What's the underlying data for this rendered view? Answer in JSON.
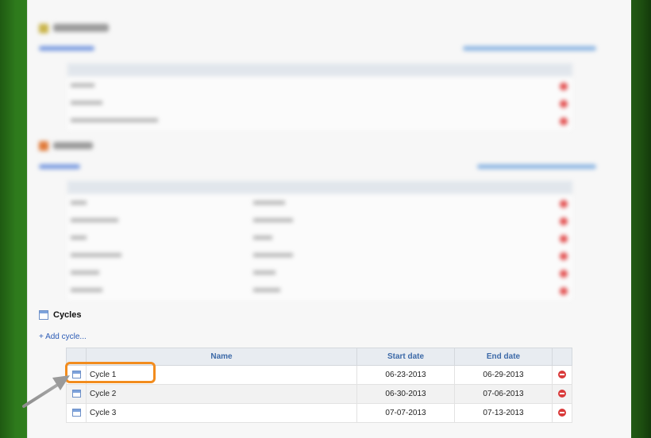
{
  "cycles": {
    "title": "Cycles",
    "add_link": "+ Add cycle...",
    "columns": [
      "",
      "Name",
      "Start date",
      "End date",
      ""
    ],
    "rows": [
      {
        "name": "Cycle 1",
        "start": "06-23-2013",
        "end": "06-29-2013"
      },
      {
        "name": "Cycle 2",
        "start": "06-30-2013",
        "end": "07-06-2013"
      },
      {
        "name": "Cycle 3",
        "start": "07-07-2013",
        "end": "07-13-2013"
      }
    ]
  },
  "colors": {
    "highlight": "#f28c1e",
    "header_text": "#3d6aa8",
    "link": "#2b5bb5",
    "delete": "#d93a3a"
  },
  "icons": {
    "section": "calendar-icon",
    "row": "calendar-icon",
    "delete": "delete-circle-icon",
    "annotation": "arrow-pointer-icon"
  }
}
